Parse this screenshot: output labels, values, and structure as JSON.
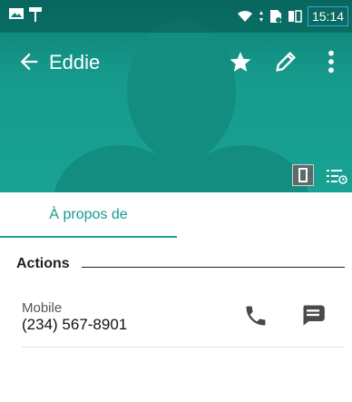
{
  "status_bar": {
    "time": "15:14"
  },
  "app_bar": {
    "title": "Eddie"
  },
  "tabs": [
    {
      "label": "À propos de",
      "active": true
    }
  ],
  "sections": {
    "actions_title": "Actions"
  },
  "contact": {
    "phone_type": "Mobile",
    "phone_number": "(234) 567-8901"
  },
  "colors": {
    "accent": "#19a594",
    "header_bg": "#169a8c"
  },
  "icons": [
    "back-arrow-icon",
    "star-icon",
    "pencil-icon",
    "more-vert-icon",
    "phone-icon",
    "message-icon",
    "wifi-icon",
    "battery-icon"
  ]
}
